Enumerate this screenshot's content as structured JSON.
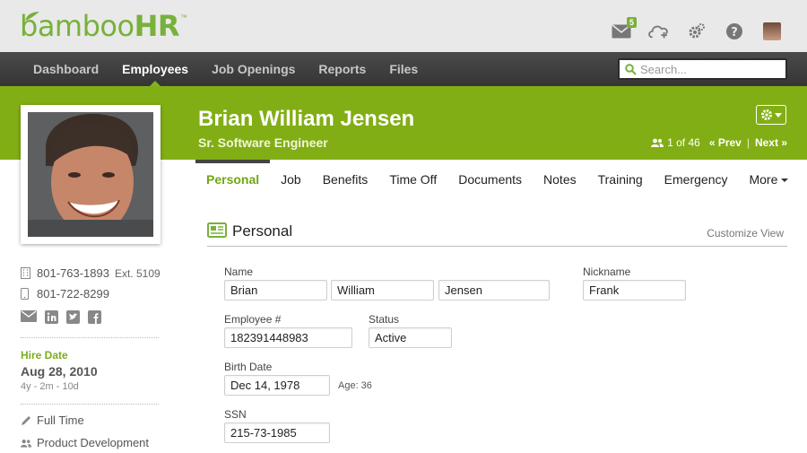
{
  "header": {
    "logo_text_light": "bamboo",
    "logo_text_bold": "HR",
    "logo_tm": "™",
    "inbox_badge": "5",
    "icons": [
      "mail-icon",
      "cloud-upload-icon",
      "settings-gear-icon",
      "help-icon",
      "user-avatar"
    ]
  },
  "nav": {
    "items": [
      "Dashboard",
      "Employees",
      "Job Openings",
      "Reports",
      "Files"
    ],
    "active": "Employees",
    "search_placeholder": "Search..."
  },
  "employee": {
    "name": "Brian William Jensen",
    "title": "Sr. Software Engineer",
    "pager_count": "1 of 46",
    "prev": "« Prev",
    "next": "Next »",
    "separator": "|"
  },
  "tabs": {
    "items": [
      "Personal",
      "Job",
      "Benefits",
      "Time Off",
      "Documents",
      "Notes",
      "Training",
      "Emergency",
      "More"
    ],
    "active": "Personal"
  },
  "section": {
    "title": "Personal",
    "customize": "Customize View"
  },
  "fields": {
    "name_label": "Name",
    "first_name": "Brian",
    "middle_name": "William",
    "last_name": "Jensen",
    "nickname_label": "Nickname",
    "nickname": "Frank",
    "employee_no_label": "Employee #",
    "employee_no": "182391448983",
    "status_label": "Status",
    "status": "Active",
    "birth_label": "Birth Date",
    "birth_date": "Dec 14, 1978",
    "age": "Age: 36",
    "ssn_label": "SSN",
    "ssn": "215-73-1985"
  },
  "sidebar": {
    "work_phone": "801-763-1893",
    "ext": "Ext. 5109",
    "mobile_phone": "801-722-8299",
    "hire_label": "Hire Date",
    "hire_date": "Aug 28, 2010",
    "tenure": "4y - 2m - 10d",
    "employment_type": "Full Time",
    "department": "Product Development"
  },
  "colors": {
    "brand_green": "#82ae15",
    "accent_green": "#78b13b",
    "nav_dark": "#3d3d3d"
  }
}
